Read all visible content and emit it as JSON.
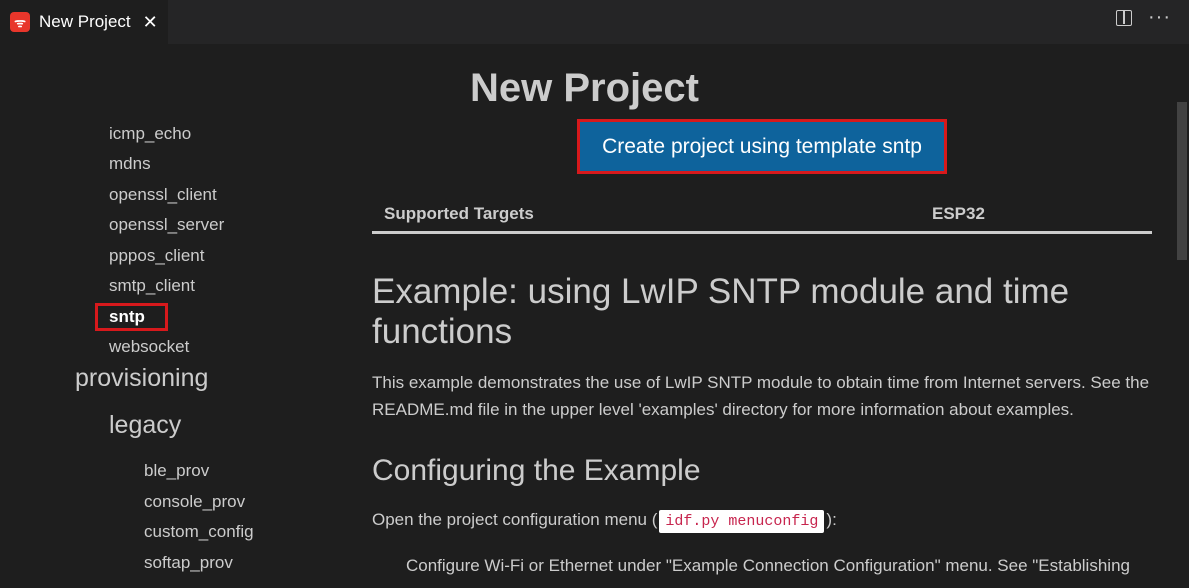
{
  "tab": {
    "title": "New Project",
    "close": "✕",
    "logo_icon": "espressif-logo-icon"
  },
  "tab_actions": {
    "split_icon": "split-editor-icon",
    "more": "···"
  },
  "sidebar": {
    "items": [
      {
        "label": "icmp_echo"
      },
      {
        "label": "mdns"
      },
      {
        "label": "openssl_client"
      },
      {
        "label": "openssl_server"
      },
      {
        "label": "pppos_client"
      },
      {
        "label": "smtp_client"
      },
      {
        "label": "sntp",
        "selected": true
      },
      {
        "label": "websocket"
      }
    ],
    "section_provisioning": "provisioning",
    "section_legacy": "legacy",
    "legacy_items": [
      {
        "label": "ble_prov"
      },
      {
        "label": "console_prov"
      },
      {
        "label": "custom_config"
      },
      {
        "label": "softap_prov"
      }
    ]
  },
  "content": {
    "page_title": "New Project",
    "create_button": "Create project using template sntp",
    "targets_header": "Supported Targets",
    "targets_value": "ESP32",
    "heading1": "Example: using LwIP SNTP module and time functions",
    "description": "This example demonstrates the use of LwIP SNTP module to obtain time from Internet servers. See the README.md file in the upper level 'examples' directory for more information about examples.",
    "heading2": "Configuring the Example",
    "config_prefix": "Open the project configuration menu (",
    "config_code": "idf.py menuconfig",
    "config_suffix": "):",
    "bullet_text": "Configure Wi-Fi or Ethernet under \"Example Connection Configuration\" menu. See \"Establishing"
  },
  "colors": {
    "background": "#1e1e1e",
    "button": "#0e639c",
    "highlight": "#d7191c"
  }
}
